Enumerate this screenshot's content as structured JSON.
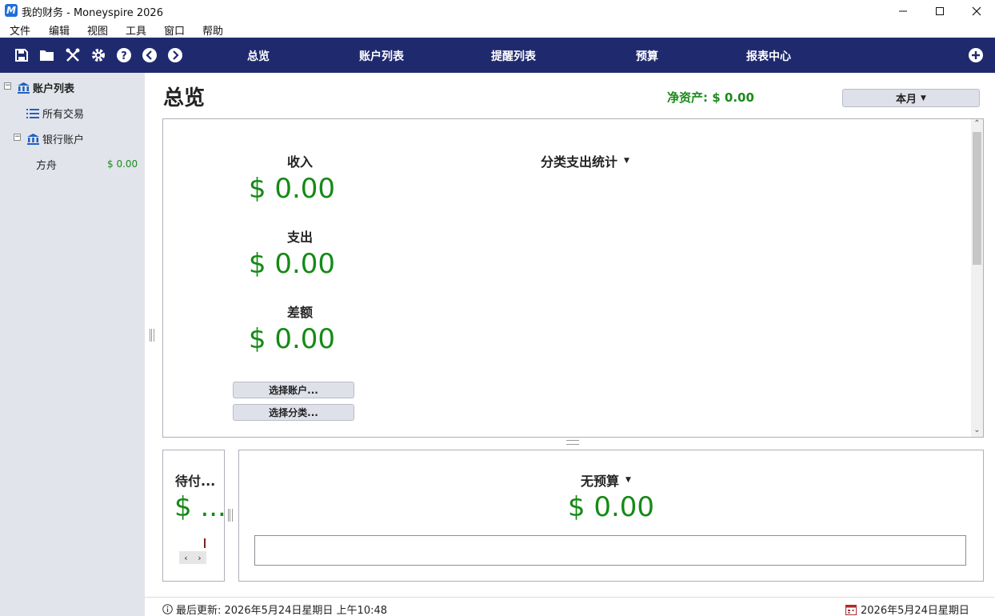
{
  "window": {
    "title": "我的财务 - Moneyspire 2026",
    "app_icon_letter": "M"
  },
  "menu": [
    "文件",
    "编辑",
    "视图",
    "工具",
    "窗口",
    "帮助"
  ],
  "toolbar": {
    "icons": [
      "save-icon",
      "folder-open-icon",
      "tools-icon",
      "gear-icon",
      "help-icon",
      "back-icon",
      "forward-icon",
      "add-icon"
    ],
    "tabs": [
      "总览",
      "账户列表",
      "提醒列表",
      "预算",
      "报表中心"
    ],
    "active_tab": "总览"
  },
  "sidebar": {
    "header": "账户列表",
    "all_transactions": "所有交易",
    "group": "银行账户",
    "account": {
      "name": "方舟",
      "balance": "$ 0.00"
    }
  },
  "main": {
    "title": "总览",
    "net_worth": "净资产: $ 0.00",
    "period": "本月",
    "income_label": "收入",
    "income_value": "$ 0.00",
    "expense_label": "支出",
    "expense_value": "$ 0.00",
    "diff_label": "差额",
    "diff_value": "$ 0.00",
    "select_accounts": "选择账户...",
    "select_categories": "选择分类...",
    "category_chart_title": "分类支出统计"
  },
  "bottom": {
    "pending_title": "待付...",
    "pending_value": "$ ...",
    "budget_title": "无预算",
    "budget_value": "$ 0.00"
  },
  "status": {
    "last_updated": "最后更新: 2026年5月24日星期日 上午10:48",
    "date": "2026年5月24日星期日"
  },
  "colors": {
    "toolbar_bg": "#1f2a6e",
    "amount_green": "#158a15",
    "sidebar_bg": "#e2e4ec"
  }
}
